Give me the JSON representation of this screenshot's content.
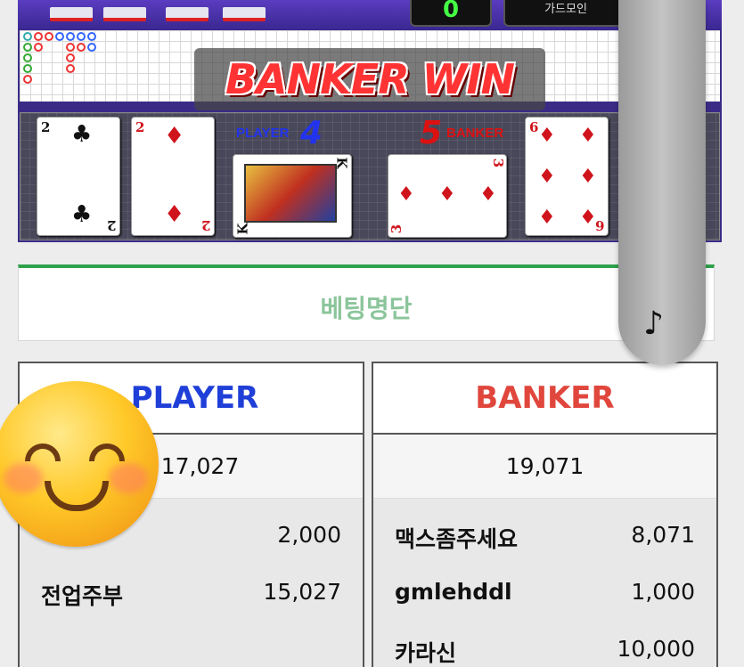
{
  "game": {
    "score_display": "0",
    "mode_display": "가드모인",
    "result_banner": "BANKER WIN",
    "player_label": "PLAYER",
    "player_score": "4",
    "banker_label": "BANKER",
    "banker_score": "5",
    "player_cards": [
      {
        "rank": "2",
        "suit": "♣",
        "color": "black"
      },
      {
        "rank": "2",
        "suit": "♦",
        "color": "red"
      },
      {
        "rank": "K",
        "suit": "♣",
        "color": "black"
      }
    ],
    "banker_cards": [
      {
        "rank": "3",
        "suit": "♦",
        "color": "red"
      },
      {
        "rank": "6",
        "suit": "♦",
        "color": "red"
      }
    ]
  },
  "music": {
    "icon": "music-note-icon",
    "glyph": "♪"
  },
  "bet_list": {
    "title": "베팅명단"
  },
  "player_panel": {
    "title": "PLAYER",
    "title_color": "#1f3fd8",
    "total": "17,027",
    "rows": [
      {
        "name": "",
        "amount": "2,000"
      },
      {
        "name": "전업주부",
        "amount": "15,027"
      }
    ]
  },
  "banker_panel": {
    "title": "BANKER",
    "title_color": "#e0463c",
    "total": "19,071",
    "rows": [
      {
        "name": "맥스좀주세요",
        "amount": "8,071"
      },
      {
        "name": "gmlehddl",
        "amount": "1,000"
      },
      {
        "name": "카라신",
        "amount": "10,000"
      }
    ]
  },
  "overlay": {
    "emoji": "smiling-face-emoji"
  }
}
